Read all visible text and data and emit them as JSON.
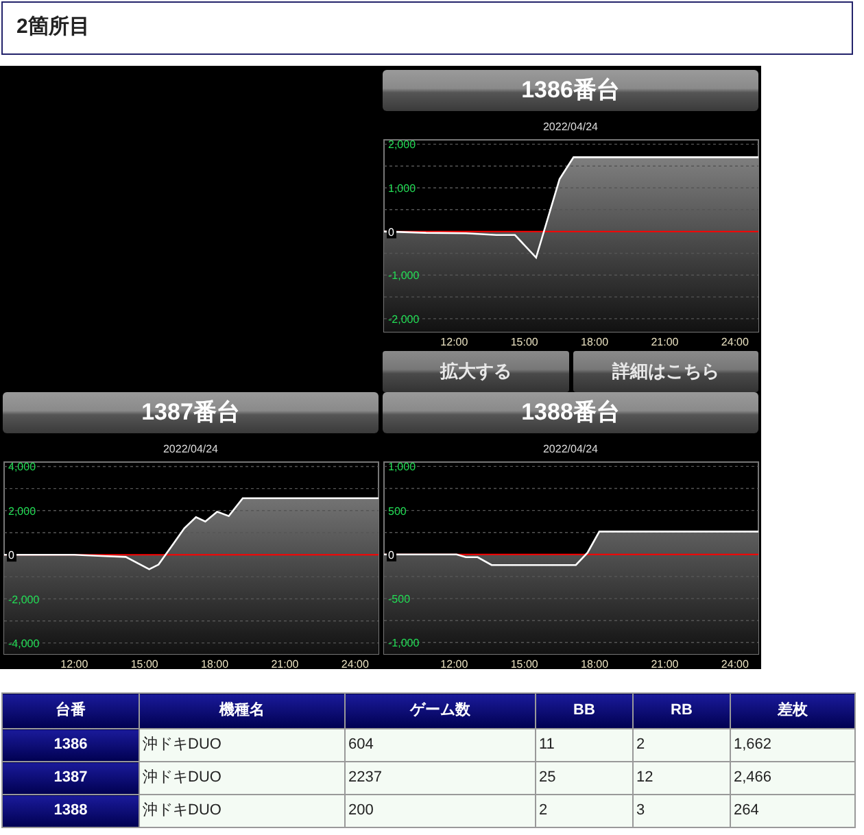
{
  "heading": "2箇所目",
  "panels": [
    {
      "title": "1386番台",
      "buttons": [
        "拡大する",
        "詳細はこちら"
      ],
      "chart_data": {
        "type": "area",
        "title": "2022/04/24",
        "x": [
          9,
          10.8,
          12.5,
          13.8,
          14.6,
          15.5,
          16.5,
          17.1,
          25
        ],
        "series": [
          {
            "color": "#ffffff",
            "values": [
              0,
              -30,
              -40,
              -80,
              -80,
              -600,
              1200,
              1700,
              1700
            ]
          }
        ],
        "ref_lines": [
          {
            "axis": "y",
            "value": 0,
            "color": "#ff0000"
          }
        ],
        "xlim": [
          9,
          25
        ],
        "ylim": [
          -2300,
          2100
        ],
        "grid": true,
        "xticks": [
          {
            "value": 12,
            "label": "12:00"
          },
          {
            "value": 15,
            "label": "15:00"
          },
          {
            "value": 18,
            "label": "18:00"
          },
          {
            "value": 21,
            "label": "21:00"
          },
          {
            "value": 24,
            "label": "24:00"
          }
        ],
        "yticks": [
          {
            "value": 2000,
            "label": "2,000"
          },
          {
            "value": 1000,
            "label": "1,000"
          },
          {
            "value": 0,
            "label": "0"
          },
          {
            "value": -1000,
            "label": "-1,000"
          },
          {
            "value": -2000,
            "label": "-2,000"
          }
        ]
      }
    },
    {
      "title": "1387番台",
      "chart_data": {
        "type": "area",
        "title": "2022/04/24",
        "x": [
          9,
          12,
          13,
          14.2,
          15.2,
          15.6,
          16.7,
          17.2,
          17.6,
          18.1,
          18.6,
          19.2,
          25
        ],
        "series": [
          {
            "color": "#ffffff",
            "values": [
              0,
              0,
              -50,
              -100,
              -660,
              -450,
              1200,
              1700,
              1500,
              1950,
              1750,
              2560,
              2560
            ]
          }
        ],
        "ref_lines": [
          {
            "axis": "y",
            "value": 0,
            "color": "#ff0000"
          }
        ],
        "xlim": [
          9,
          25
        ],
        "ylim": [
          -4500,
          4200
        ],
        "grid": true,
        "xticks": [
          {
            "value": 12,
            "label": "12:00"
          },
          {
            "value": 15,
            "label": "15:00"
          },
          {
            "value": 18,
            "label": "18:00"
          },
          {
            "value": 21,
            "label": "21:00"
          },
          {
            "value": 24,
            "label": "24:00"
          }
        ],
        "yticks": [
          {
            "value": 4000,
            "label": "4,000"
          },
          {
            "value": 2000,
            "label": "2,000"
          },
          {
            "value": 0,
            "label": "0"
          },
          {
            "value": -2000,
            "label": "-2,000"
          },
          {
            "value": -4000,
            "label": "-4,000"
          }
        ]
      }
    },
    {
      "title": "1388番台",
      "chart_data": {
        "type": "area",
        "title": "2022/04/24",
        "x": [
          9,
          12.1,
          12.5,
          13,
          13.6,
          17.2,
          17.7,
          18.2,
          25
        ],
        "series": [
          {
            "color": "#ffffff",
            "values": [
              0,
              0,
              -30,
              -30,
              -120,
              -120,
              20,
              260,
              260
            ]
          }
        ],
        "ref_lines": [
          {
            "axis": "y",
            "value": 0,
            "color": "#ff0000"
          }
        ],
        "xlim": [
          9,
          25
        ],
        "ylim": [
          -1130,
          1050
        ],
        "grid": true,
        "xticks": [
          {
            "value": 12,
            "label": "12:00"
          },
          {
            "value": 15,
            "label": "15:00"
          },
          {
            "value": 18,
            "label": "18:00"
          },
          {
            "value": 21,
            "label": "21:00"
          },
          {
            "value": 24,
            "label": "24:00"
          }
        ],
        "yticks": [
          {
            "value": 1000,
            "label": "1,000"
          },
          {
            "value": 500,
            "label": "500"
          },
          {
            "value": 0,
            "label": "0"
          },
          {
            "value": -500,
            "label": "-500"
          },
          {
            "value": -1000,
            "label": "-1,000"
          }
        ]
      }
    }
  ],
  "table": {
    "columns": [
      "台番",
      "機種名",
      "ゲーム数",
      "BB",
      "RB",
      "差枚"
    ],
    "rows": [
      [
        "1386",
        "沖ドキDUO",
        "604",
        "11",
        "2",
        "1,662"
      ],
      [
        "1387",
        "沖ドキDUO",
        "2237",
        "25",
        "12",
        "2,466"
      ],
      [
        "1388",
        "沖ドキDUO",
        "200",
        "2",
        "3",
        "264"
      ]
    ]
  }
}
